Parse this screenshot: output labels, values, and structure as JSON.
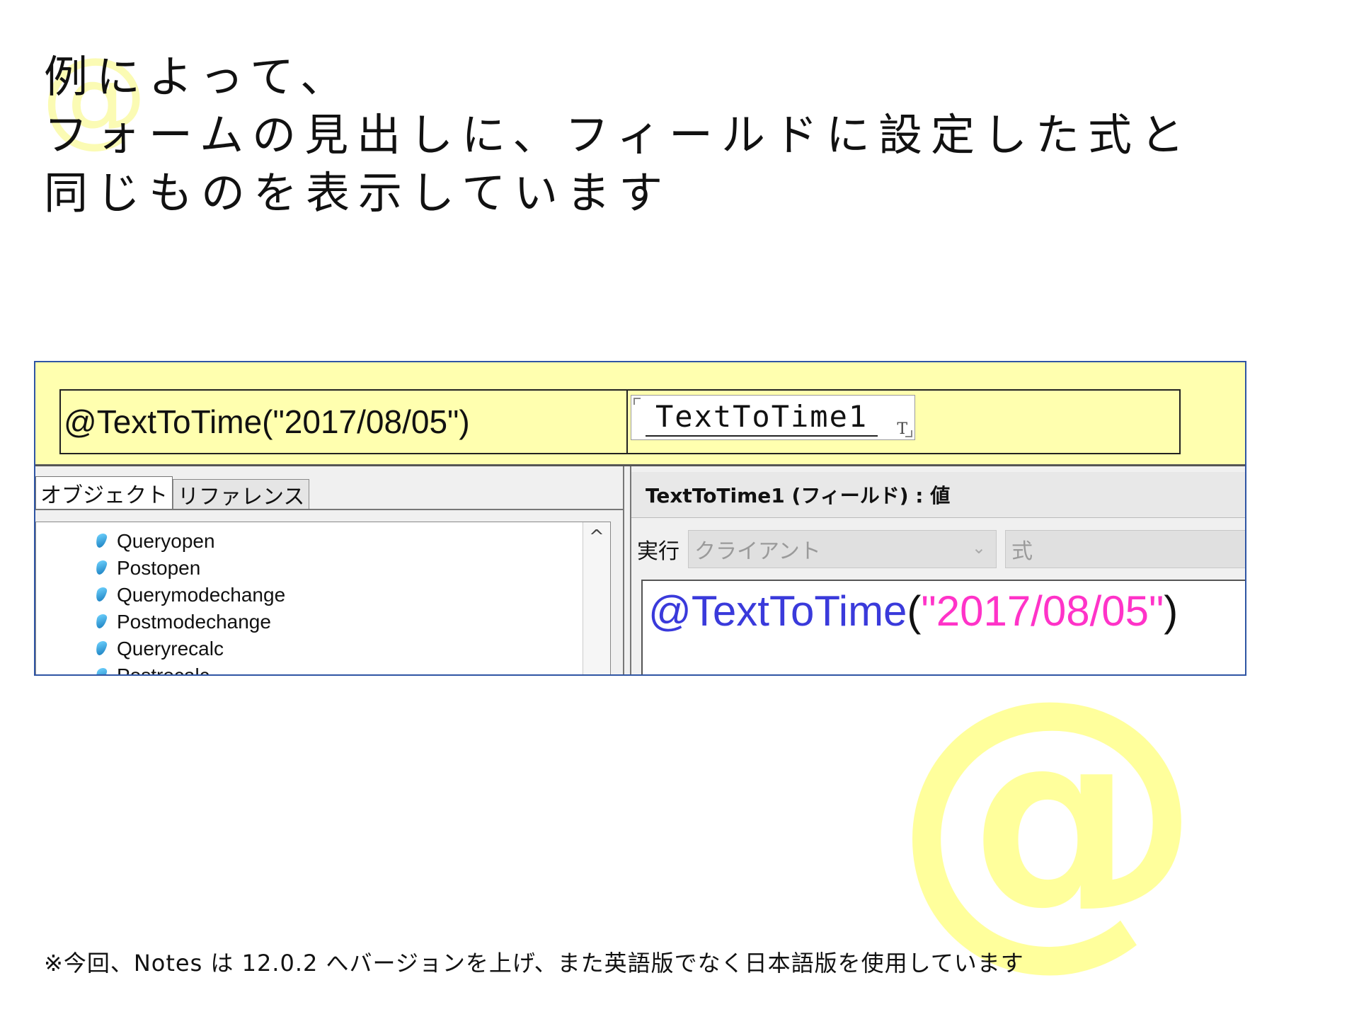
{
  "slide": {
    "title_lines": [
      "例によって、",
      "フォームの見出しに、フィールドに設定した式と",
      "同じものを表示しています"
    ],
    "footnote": "※今回、Notes は 12.0.2 へバージョンを上げ、また英語版でなく日本語版を使用しています",
    "watermark_glyph": "@"
  },
  "form": {
    "caption_text": "@TextToTime(\"2017/08/05\")",
    "field_name": "TextToTime1",
    "field_type_marker": "T"
  },
  "designer": {
    "tabs": [
      "オブジェクト",
      "リファレンス"
    ],
    "events": [
      "Queryopen",
      "Postopen",
      "Querymodechange",
      "Postmodechange",
      "Queryrecalc",
      "Postrecalc"
    ],
    "scroll_up_glyph": "^",
    "object_header": "TextToTime1 (フィールド) : 値",
    "run_label": "実行",
    "run_target": "クライアント",
    "language": "式",
    "combo_arrow_glyph": "⌄",
    "formula": {
      "function": "@TextToTime",
      "open_paren": "(",
      "argument": "\"2017/08/05\"",
      "close_paren": ")"
    }
  },
  "colors": {
    "panel_background": "#ffffaf",
    "panel_border": "#2f55a4",
    "formula_function": "#3a3adb",
    "formula_string": "#ff33c8",
    "watermark": "#ffff9c"
  }
}
